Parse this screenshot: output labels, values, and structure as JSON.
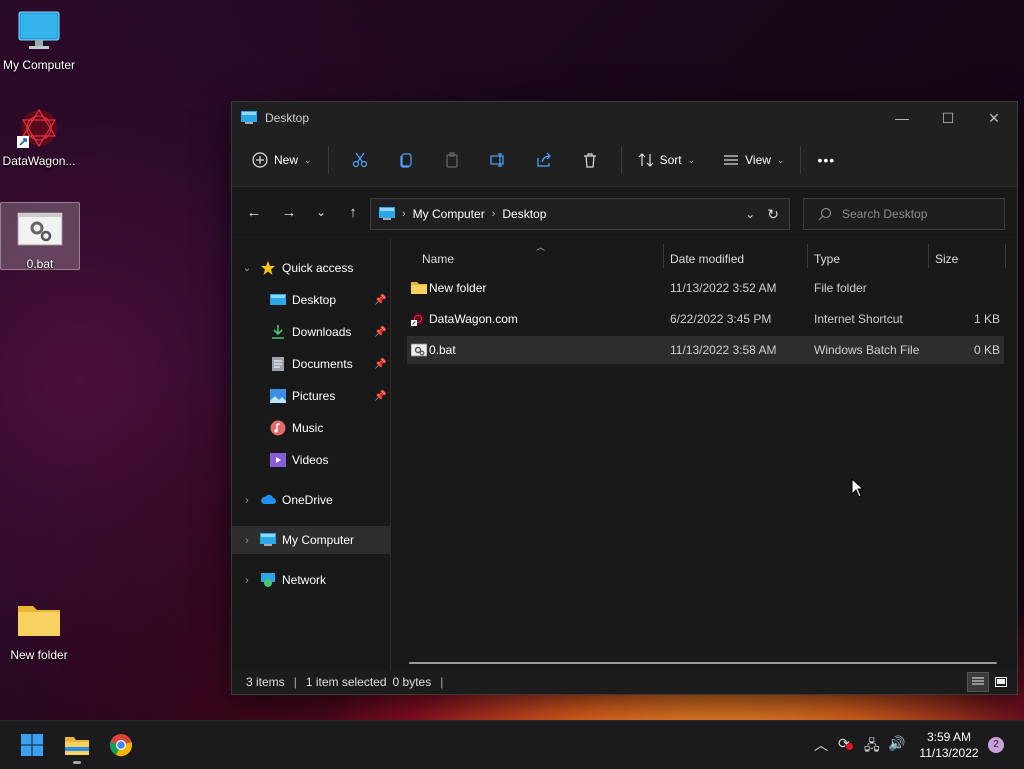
{
  "desktop": {
    "icons": [
      {
        "label": "My Computer",
        "icon": "monitor-icon"
      },
      {
        "label": "DataWagon...",
        "icon": "datawagon-shortcut-icon"
      },
      {
        "label": "0.bat",
        "icon": "batch-file-icon"
      },
      {
        "label": "New folder",
        "icon": "folder-icon"
      }
    ]
  },
  "window": {
    "title": "Desktop",
    "controls": {
      "minimize": "—",
      "maximize": "☐",
      "close": "✕"
    }
  },
  "toolbar": {
    "new_label": "New",
    "sort_label": "Sort",
    "view_label": "View",
    "more_label": "•••"
  },
  "address": {
    "crumbs": [
      "My Computer",
      "Desktop"
    ],
    "search_placeholder": "Search Desktop"
  },
  "sidebar": {
    "quick_access": "Quick access",
    "items": [
      "Desktop",
      "Downloads",
      "Documents",
      "Pictures",
      "Music",
      "Videos"
    ],
    "onedrive": "OneDrive",
    "my_computer": "My Computer",
    "network": "Network"
  },
  "columns": {
    "name": "Name",
    "date": "Date modified",
    "type": "Type",
    "size": "Size"
  },
  "files": [
    {
      "name": "New folder",
      "date": "11/13/2022 3:52 AM",
      "type": "File folder",
      "size": ""
    },
    {
      "name": "DataWagon.com",
      "date": "6/22/2022 3:45 PM",
      "type": "Internet Shortcut",
      "size": "1 KB"
    },
    {
      "name": "0.bat",
      "date": "11/13/2022 3:58 AM",
      "type": "Windows Batch File",
      "size": "0 KB"
    }
  ],
  "status": {
    "items": "3 items",
    "selected": "1 item selected",
    "bytes": "0 bytes"
  },
  "clock": {
    "time": "3:59 AM",
    "date": "11/13/2022"
  },
  "notifications": "2",
  "colors": {
    "accent": "#0078d4",
    "folder": "#f4c542"
  }
}
